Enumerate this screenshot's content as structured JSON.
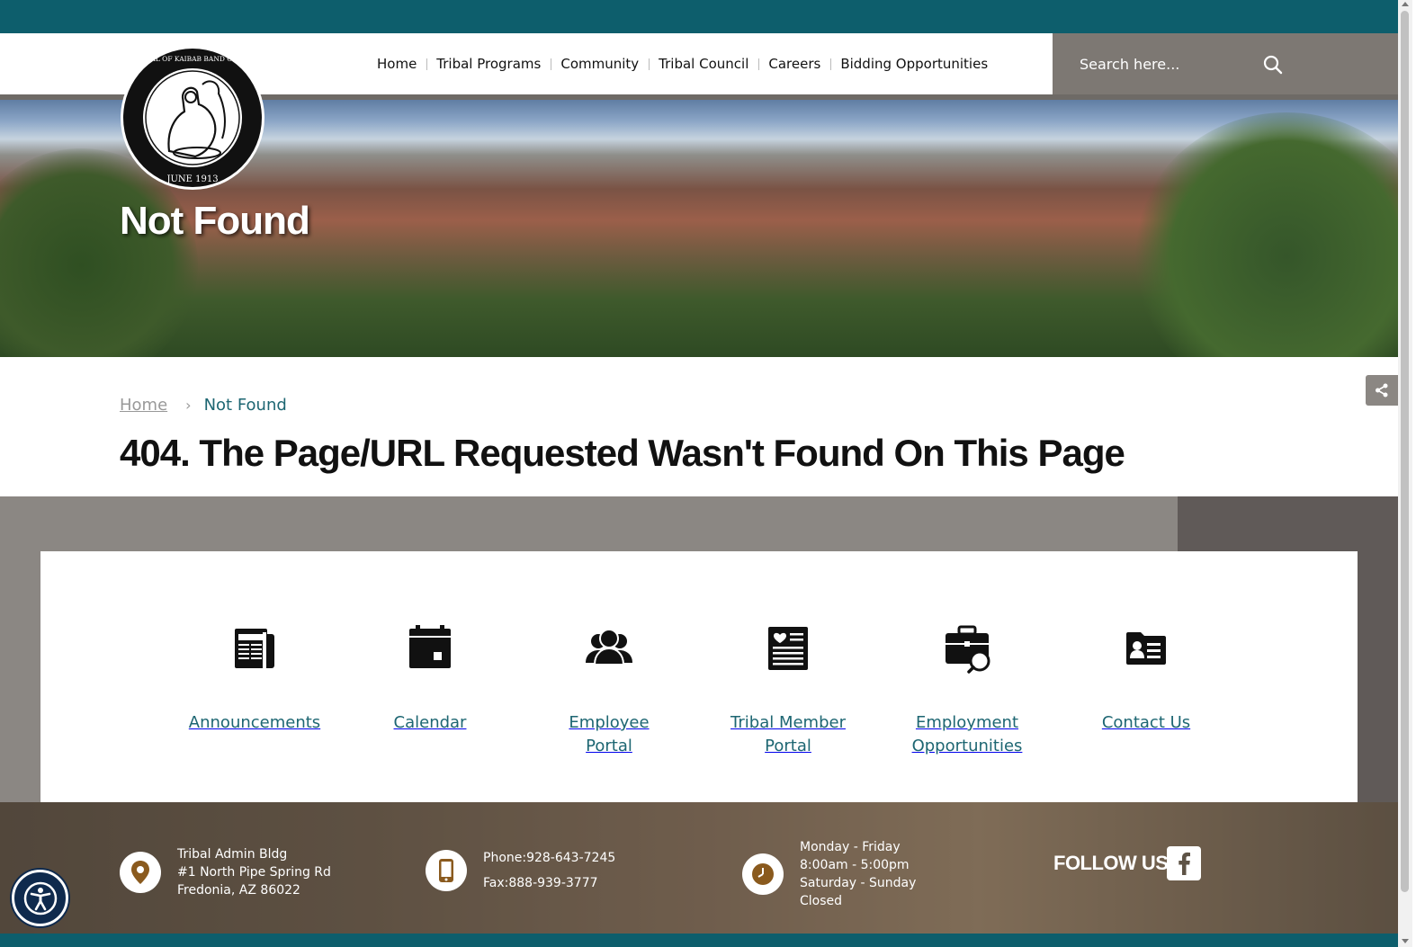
{
  "header": {
    "nav": [
      {
        "label": "Home"
      },
      {
        "label": "Tribal Programs"
      },
      {
        "label": "Community"
      },
      {
        "label": "Tribal Council"
      },
      {
        "label": "Careers"
      },
      {
        "label": "Bidding Opportunities"
      }
    ],
    "search": {
      "placeholder": "Search here..."
    },
    "seal": {
      "ring_text": "GREAT SEAL OF KAIBAB BAND OF PAIUTES",
      "date_text": "JUNE 1913"
    }
  },
  "hero": {
    "title": "Not Found"
  },
  "breadcrumb": {
    "home": "Home",
    "separator": "›",
    "current": "Not Found"
  },
  "page_heading": "404. The Page/URL Requested Wasn't Found On This Page",
  "quick_links": [
    {
      "label_lines": [
        "Announcements"
      ],
      "icon": "newspaper-icon"
    },
    {
      "label_lines": [
        "Calendar"
      ],
      "icon": "calendar-icon"
    },
    {
      "label_lines": [
        "Employee",
        "Portal"
      ],
      "icon": "users-icon"
    },
    {
      "label_lines": [
        "Tribal Member",
        "Portal"
      ],
      "icon": "member-list-icon"
    },
    {
      "label_lines": [
        "Employment",
        "Opportunities"
      ],
      "icon": "briefcase-search-icon"
    },
    {
      "label_lines": [
        "Contact Us"
      ],
      "icon": "contact-card-icon"
    }
  ],
  "footer": {
    "address": [
      "Tribal Admin Bldg",
      "#1 North Pipe Spring Rd",
      "Fredonia, AZ 86022"
    ],
    "phone": "Phone:928-643-7245",
    "fax": "Fax:888-939-3777",
    "hours": [
      "Monday - Friday",
      "8:00am - 5:00pm",
      "Saturday - Sunday",
      "Closed"
    ],
    "follow_label": "FOLLOW US"
  },
  "colors": {
    "brand_teal": "#0d5e6c",
    "link_teal": "#1d6672",
    "search_gray": "#7d7873",
    "footer_icon_brown": "#8a5a1e"
  }
}
